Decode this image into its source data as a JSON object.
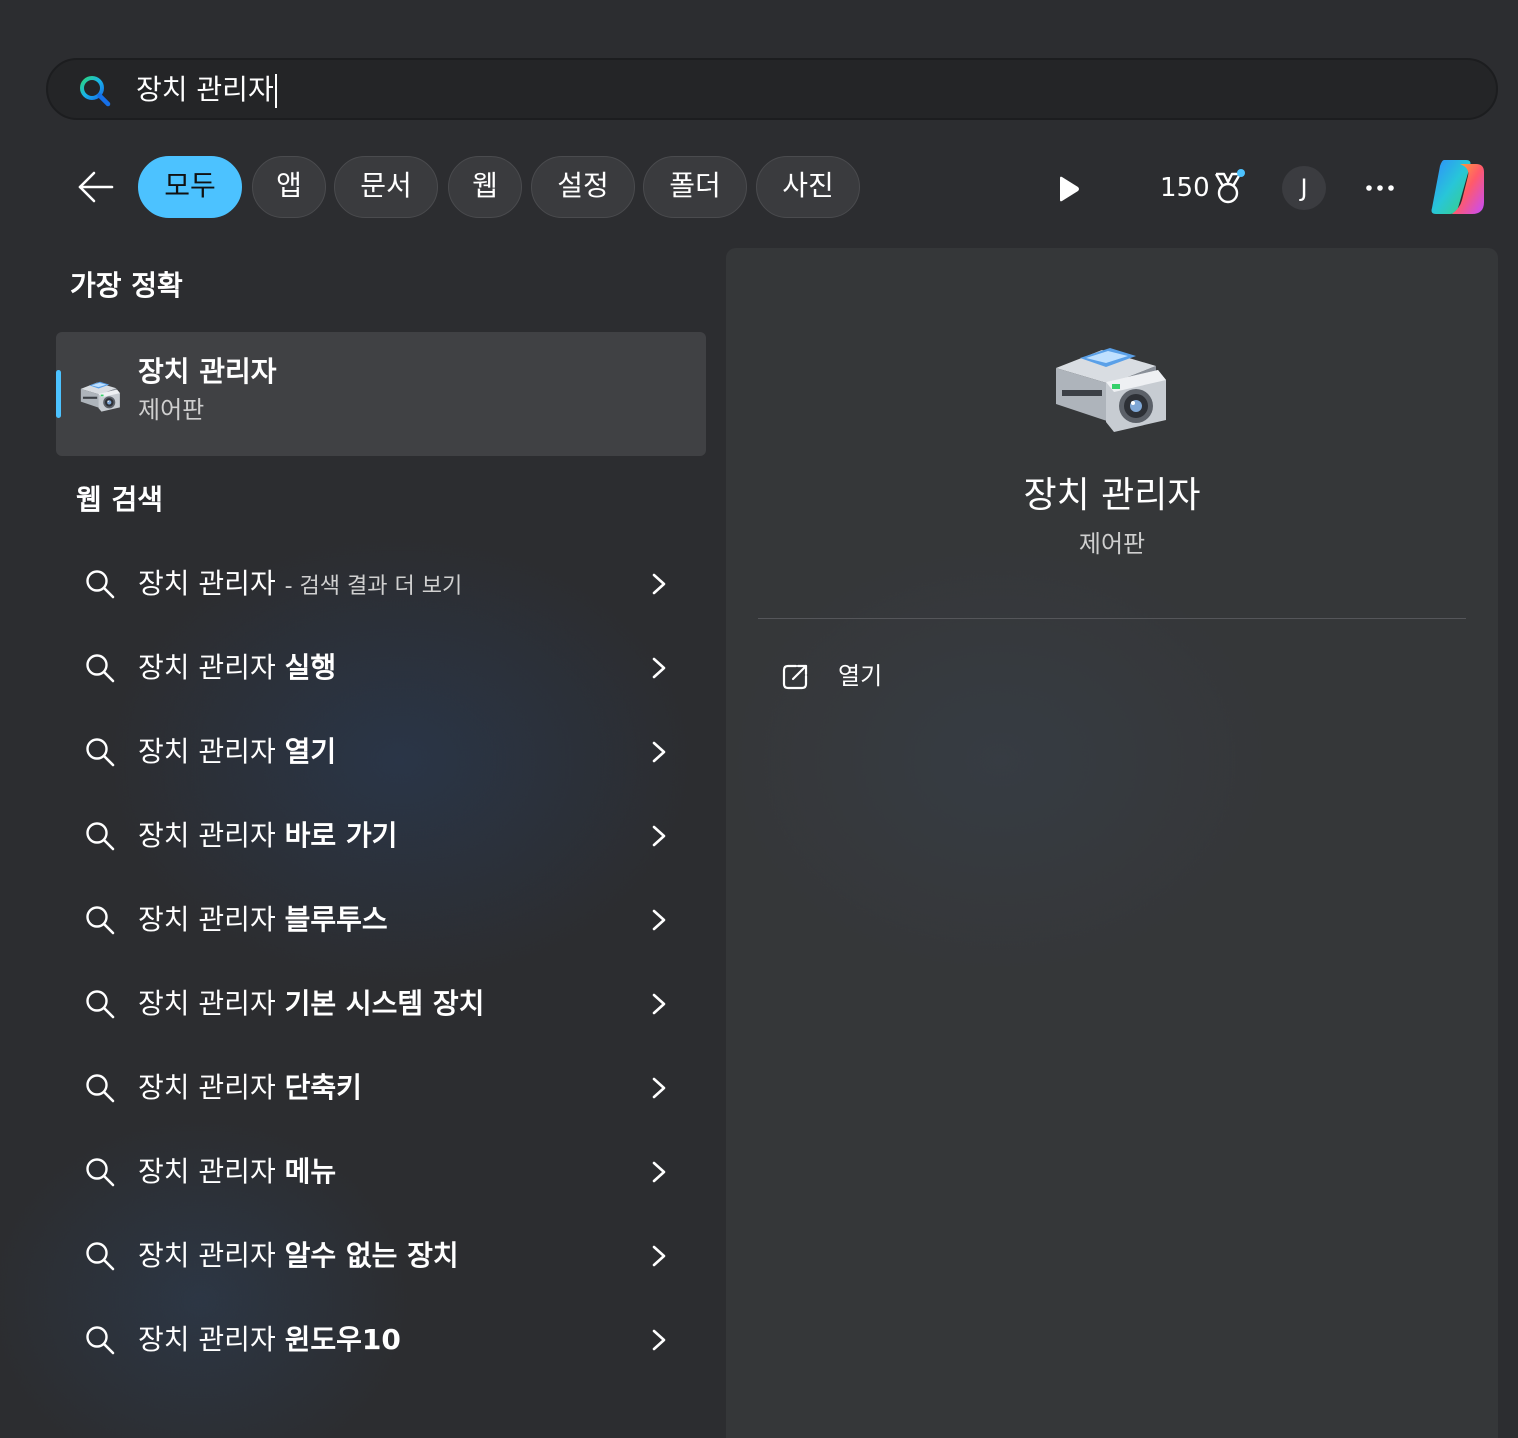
{
  "search": {
    "query": "장치 관리자"
  },
  "filters": [
    {
      "label": "모두",
      "active": true
    },
    {
      "label": "앱"
    },
    {
      "label": "문서"
    },
    {
      "label": "웹"
    },
    {
      "label": "설정"
    },
    {
      "label": "폴더"
    },
    {
      "label": "사진"
    }
  ],
  "toolbar": {
    "points": "150",
    "avatar_initial": "J"
  },
  "best_match": {
    "section_title": "가장 정확",
    "title": "장치 관리자",
    "subtitle": "제어판"
  },
  "web_search": {
    "section_title": "웹 검색",
    "items": [
      {
        "prefix": "장치 관리자",
        "suffix": "- 검색 결과 더 보기"
      },
      {
        "prefix": "장치 관리자",
        "suffix": "실행"
      },
      {
        "prefix": "장치 관리자",
        "suffix": "열기"
      },
      {
        "prefix": "장치 관리자",
        "suffix": "바로 가기"
      },
      {
        "prefix": "장치 관리자",
        "suffix": "블루투스"
      },
      {
        "prefix": "장치 관리자",
        "suffix": "기본 시스템 장치"
      },
      {
        "prefix": "장치 관리자",
        "suffix": "단축키"
      },
      {
        "prefix": "장치 관리자",
        "suffix": "메뉴"
      },
      {
        "prefix": "장치 관리자",
        "suffix": "알수 없는 장치"
      },
      {
        "prefix": "장치 관리자",
        "suffix": "윈도우10"
      }
    ]
  },
  "detail": {
    "title": "장치 관리자",
    "subtitle": "제어판",
    "actions": [
      {
        "label": "열기",
        "icon": "open-external-icon"
      }
    ]
  },
  "colors": {
    "accent": "#4cc2ff",
    "background": "#2c2d30"
  }
}
